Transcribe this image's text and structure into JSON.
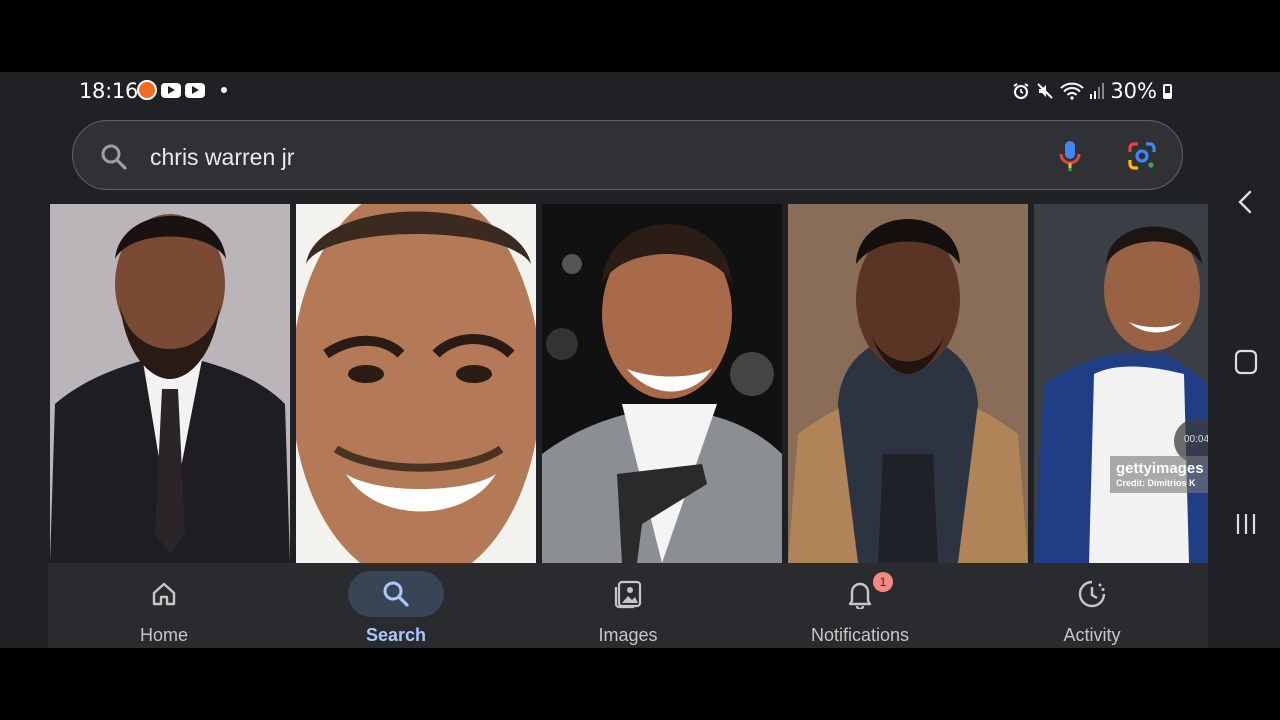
{
  "status_bar": {
    "time": "18:16",
    "battery": "30%"
  },
  "search": {
    "query": "chris warren jr"
  },
  "results": {
    "video_duration": "00:04",
    "watermark": "gettyimages",
    "watermark_credit": "Credit: Dimitrios K"
  },
  "nav": {
    "items": [
      {
        "label": "Home",
        "icon": "home-icon"
      },
      {
        "label": "Search",
        "icon": "search-icon",
        "active": true
      },
      {
        "label": "Images",
        "icon": "images-icon"
      },
      {
        "label": "Notifications",
        "icon": "bell-icon",
        "badge": "1"
      },
      {
        "label": "Activity",
        "icon": "activity-icon"
      }
    ]
  },
  "colors": {
    "background": "#202124",
    "active_accent": "#a8c7fa",
    "badge": "#f28b82"
  }
}
